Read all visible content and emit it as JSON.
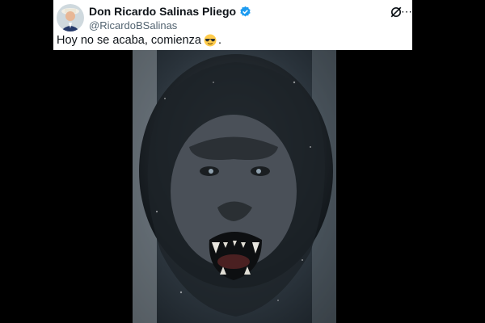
{
  "tweet": {
    "author_name": "Don Ricardo Salinas Pliego",
    "handle": "@RicardoBSalinas",
    "text": "Hoy no se acaba, comienza",
    "text_tail": ".",
    "verified_icon": "verified-badge-icon",
    "emoji": "sunglasses-emoji",
    "menu_icon": "more-icon",
    "grok_icon": "grok-icon"
  },
  "colors": {
    "text": "#0f1419",
    "secondary": "#536471",
    "verified": "#1d9bf0",
    "background": "#000000"
  },
  "media": {
    "type": "image",
    "subject": "lion-icon"
  }
}
